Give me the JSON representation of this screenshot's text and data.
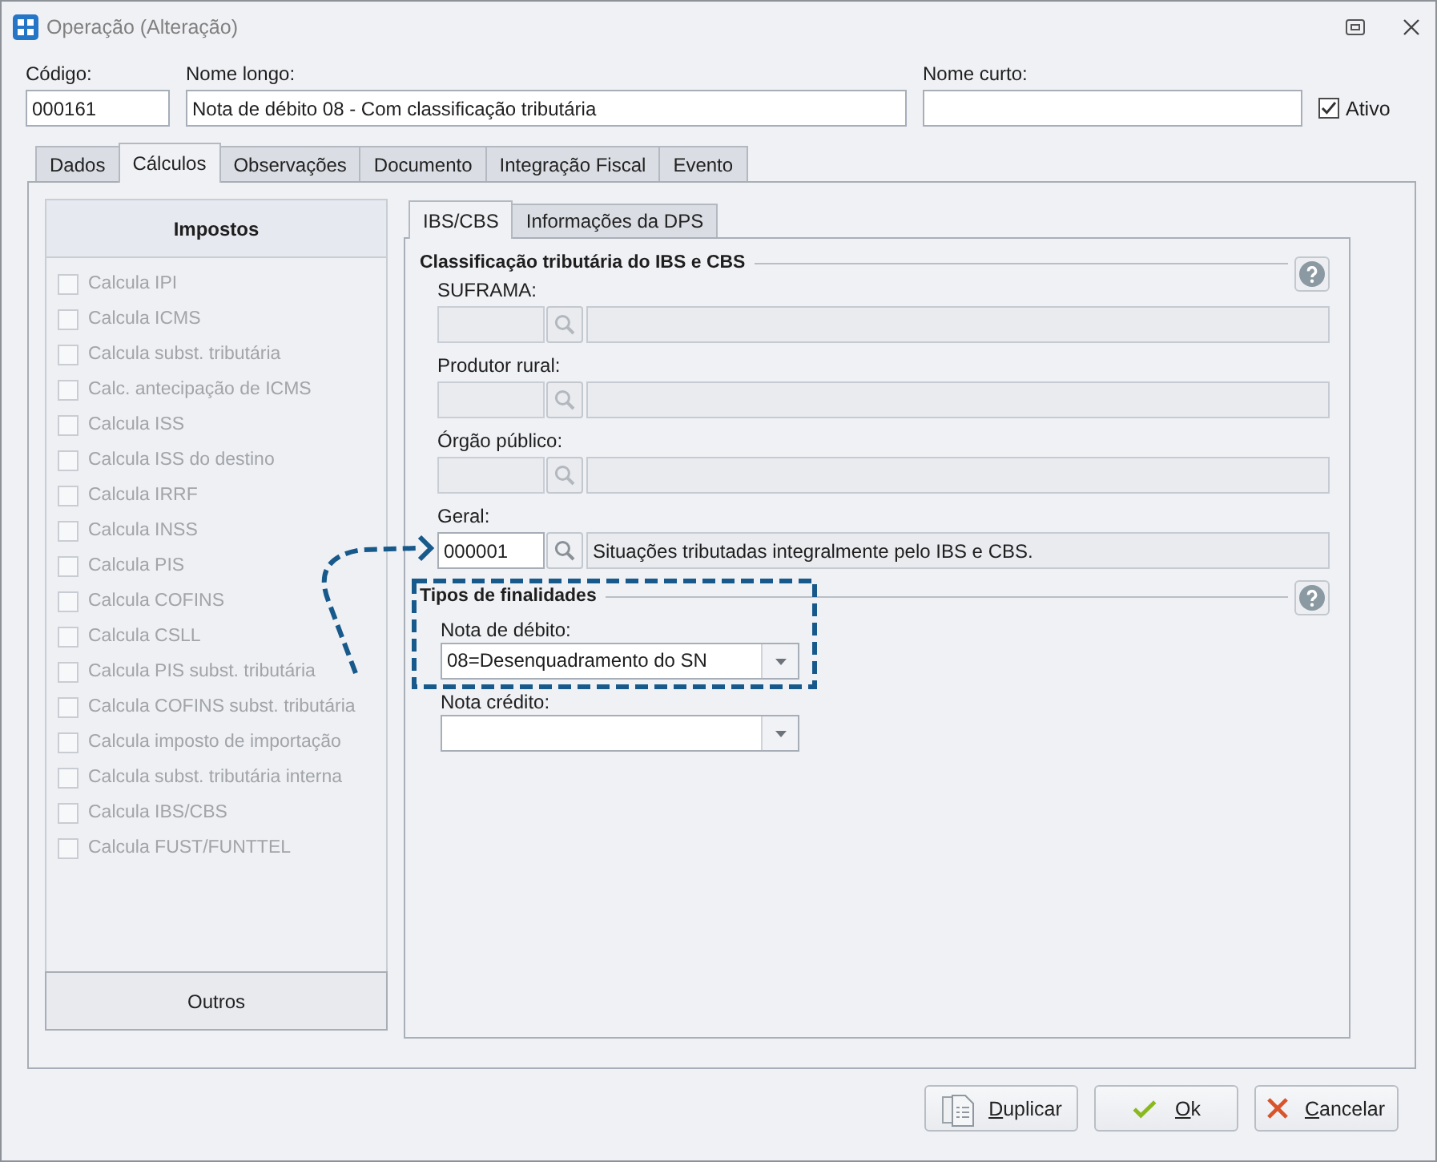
{
  "window": {
    "title": "Operação (Alteração)"
  },
  "header_fields": [
    {
      "label": "Código:",
      "value": "000161"
    },
    {
      "label": "Nome longo:",
      "value": "Nota de débito 08 - Com classificação tributária"
    },
    {
      "label": "Nome curto:"
    }
  ],
  "ativo": {
    "label": "Ativo",
    "checked": true
  },
  "tabs": [
    {
      "label": "Dados",
      "selected": false
    },
    {
      "label": "Cálculos",
      "selected": true
    },
    {
      "label": "Observações",
      "selected": false
    },
    {
      "label": "Documento",
      "selected": false
    },
    {
      "label": "Integração Fiscal",
      "selected": false
    },
    {
      "label": "Evento",
      "selected": false
    }
  ],
  "impostos_panel": {
    "title": "Impostos",
    "items": [
      {
        "label": "Calcula IPI",
        "checked": false,
        "disabled": true
      },
      {
        "label": "Calcula ICMS",
        "checked": false,
        "disabled": true
      },
      {
        "label": "Calcula subst. tributária",
        "checked": false,
        "disabled": true
      },
      {
        "label": "Calc. antecipação de ICMS",
        "checked": false,
        "disabled": true
      },
      {
        "label": "Calcula ISS",
        "checked": false,
        "disabled": true
      },
      {
        "label": "Calcula ISS do destino",
        "checked": false,
        "disabled": true
      },
      {
        "label": "Calcula IRRF",
        "checked": false,
        "disabled": true
      },
      {
        "label": "Calcula INSS",
        "checked": false,
        "disabled": true
      },
      {
        "label": "Calcula PIS",
        "checked": false,
        "disabled": true
      },
      {
        "label": "Calcula COFINS",
        "checked": false,
        "disabled": true
      },
      {
        "label": "Calcula CSLL",
        "checked": false,
        "disabled": true
      },
      {
        "label": "Calcula PIS subst. tributária",
        "checked": false,
        "disabled": true
      },
      {
        "label": "Calcula COFINS subst. tributária",
        "checked": false,
        "disabled": true
      },
      {
        "label": "Calcula imposto de importação",
        "checked": false,
        "disabled": true
      },
      {
        "label": "Calcula subst. tributária interna",
        "checked": false,
        "disabled": true
      },
      {
        "label": "Calcula IBS/CBS",
        "checked": false,
        "disabled": true
      },
      {
        "label": "Calcula FUST/FUNTTEL",
        "checked": false,
        "disabled": true
      }
    ],
    "footer": "Outros"
  },
  "sub_tabs": [
    {
      "label": "IBS/CBS",
      "selected": true
    },
    {
      "label": "Informações da DPS",
      "selected": false
    }
  ],
  "classificacao_group": {
    "title": "Classificação tributária do IBS e CBS",
    "fields": [
      {
        "label": "SUFRAMA:",
        "disabled": true,
        "pointed": false
      },
      {
        "label": "Produtor rural:",
        "disabled": true,
        "pointed": false
      },
      {
        "label": "Órgão público:",
        "disabled": true,
        "pointed": false
      },
      {
        "label": "Geral:",
        "disabled": false,
        "pointed": true,
        "code": "000001",
        "description": "Situações tributadas integralmente pelo IBS e CBS."
      }
    ]
  },
  "finalidades_group": {
    "title": "Tipos de finalidades",
    "highlighted": true,
    "fields": [
      {
        "label": "Nota de débito:",
        "value": "08=Desenquadramento do SN"
      },
      {
        "label": "Nota crédito:"
      }
    ]
  },
  "buttons": [
    {
      "label": "Duplicar",
      "kind": "duplicate",
      "underline_first": true
    },
    {
      "label": "Ok",
      "kind": "confirm",
      "underline_first": true
    },
    {
      "label": "Cancelar",
      "kind": "cancel",
      "underline_first": true
    }
  ]
}
